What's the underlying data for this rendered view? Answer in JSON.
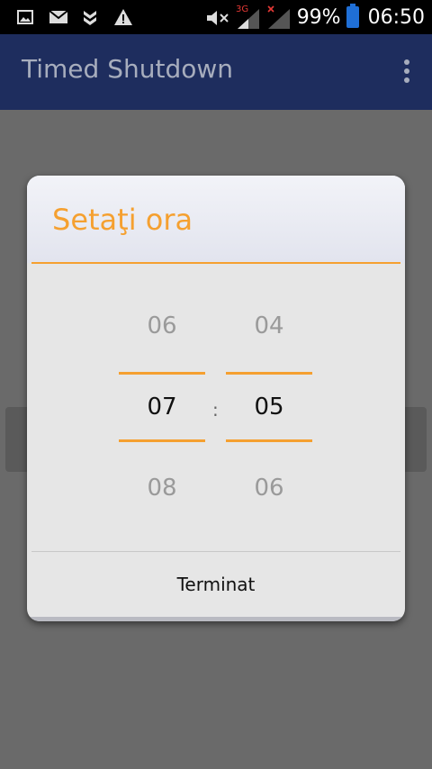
{
  "status_bar": {
    "battery": "99%",
    "time": "06:50",
    "network": "3G",
    "icons": [
      "image-icon",
      "mail-icon",
      "download-icon",
      "warning-icon",
      "mute-icon",
      "signal-3g-icon",
      "signal-no-service-icon",
      "battery-icon"
    ]
  },
  "app_bar": {
    "title": "Timed Shutdown",
    "overflow_icon": "more-vert-icon"
  },
  "dialog": {
    "title": "Setaţi ora",
    "separator": ":",
    "hours": {
      "prev": "06",
      "current": "07",
      "next": "08"
    },
    "minutes": {
      "prev": "04",
      "current": "05",
      "next": "06"
    },
    "done_label": "Terminat",
    "accent_color": "#f5a030"
  },
  "colors": {
    "app_bar": "#1e2d5e",
    "status_bar": "#000000",
    "scrim": "#6a6a6a",
    "battery": "#1f6fd6"
  }
}
